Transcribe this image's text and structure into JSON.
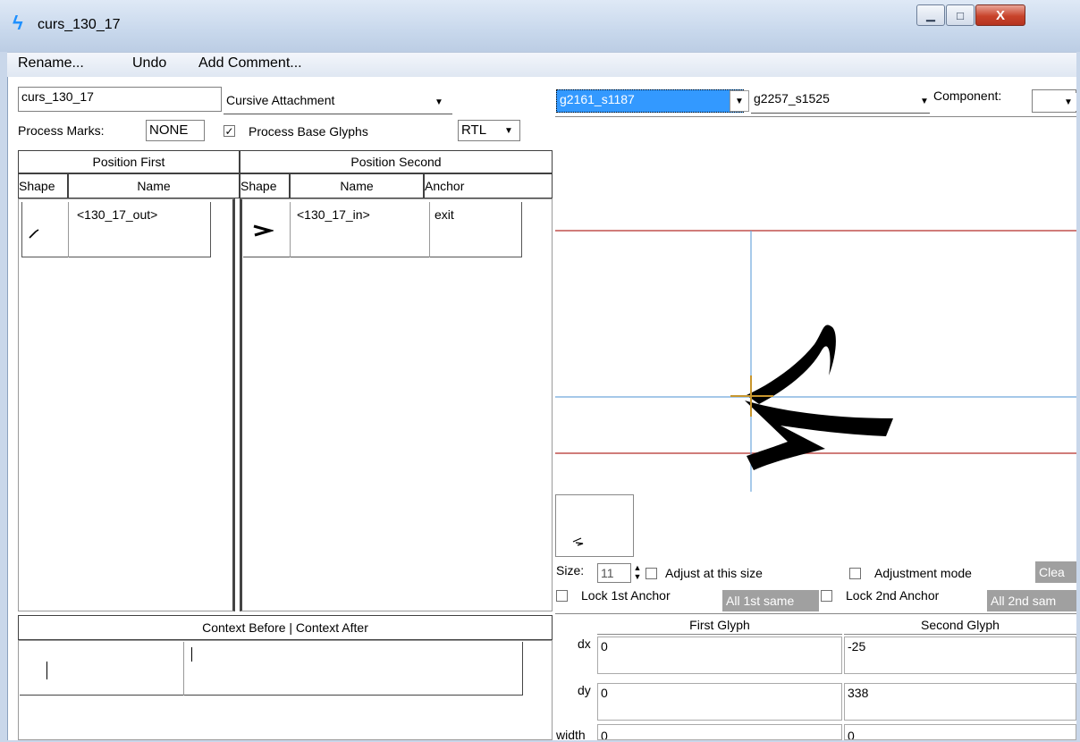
{
  "window": {
    "title": "curs_130_17",
    "minimize": "▁",
    "maximize": "□",
    "close": "X",
    "icon": "lightning-icon"
  },
  "menu": {
    "items": [
      "Rename...",
      "Undo",
      "Add Comment..."
    ]
  },
  "lookup": {
    "name": "curs_130_17",
    "type": "Cursive Attachment",
    "process_marks_label": "Process Marks:",
    "process_marks_value": "NONE",
    "process_base_label": "Process Base Glyphs",
    "process_base_checked": true,
    "direction": "RTL"
  },
  "table": {
    "header_first": "Position First",
    "header_second": "Position Second",
    "col_shape": "Shape",
    "col_name": "Name",
    "col_anchor": "Anchor",
    "first_rows": [
      {
        "shape": "stroke-glyph-icon",
        "name": "<130_17_out>"
      }
    ],
    "second_rows": [
      {
        "shape": "chevron-glyph-icon",
        "name": "<130_17_in>",
        "anchor": "exit"
      }
    ]
  },
  "context": {
    "header": "Context Before | Context After"
  },
  "preview": {
    "glyph1": "g2161_s1187",
    "glyph2": "g2257_s1525",
    "component_label": "Component:",
    "size_label": "Size:",
    "size_value": "11",
    "adjust_size_label": "Adjust at this size",
    "adjust_mode_label": "Adjustment mode",
    "clear_label": "Clea",
    "lock1_label": "Lock 1st Anchor",
    "all1_label": "All 1st same",
    "lock2_label": "Lock 2nd Anchor",
    "all2_label": "All 2nd sam"
  },
  "adjust": {
    "col_first": "First Glyph",
    "col_second": "Second Glyph",
    "rows": [
      {
        "label": "dx",
        "first": "0",
        "second": "-25"
      },
      {
        "label": "dy",
        "first": "0",
        "second": "338"
      },
      {
        "label": "width",
        "first": "0",
        "second": "0"
      }
    ]
  },
  "colors": {
    "metric_line": "#c0504d",
    "guide_line": "#6fa8dc",
    "anchor": "#c8962e",
    "selection": "#3399ff"
  }
}
